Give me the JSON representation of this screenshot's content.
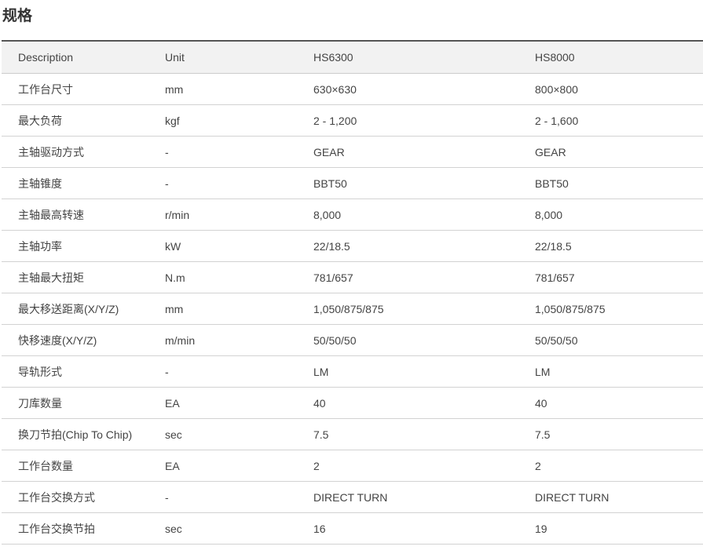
{
  "page": {
    "title": "规格"
  },
  "table": {
    "headers": [
      "Description",
      "Unit",
      "HS6300",
      "HS8000"
    ],
    "rows": [
      [
        "工作台尺寸",
        "mm",
        "630×630",
        "800×800"
      ],
      [
        "最大负荷",
        "kgf",
        "2 - 1,200",
        "2 - 1,600"
      ],
      [
        "主轴驱动方式",
        "-",
        "GEAR",
        "GEAR"
      ],
      [
        "主轴锥度",
        "-",
        "BBT50",
        "BBT50"
      ],
      [
        "主轴最高转速",
        "r/min",
        "8,000",
        "8,000"
      ],
      [
        "主轴功率",
        "kW",
        "22/18.5",
        "22/18.5"
      ],
      [
        "主轴最大扭矩",
        "N.m",
        "781/657",
        "781/657"
      ],
      [
        "最大移送距离(X/Y/Z)",
        "mm",
        "1,050/875/875",
        "1,050/875/875"
      ],
      [
        "快移速度(X/Y/Z)",
        "m/min",
        "50/50/50",
        "50/50/50"
      ],
      [
        "导轨形式",
        "-",
        "LM",
        "LM"
      ],
      [
        "刀库数量",
        "EA",
        "40",
        "40"
      ],
      [
        "换刀节拍(Chip To Chip)",
        "sec",
        "7.5",
        "7.5"
      ],
      [
        "工作台数量",
        "EA",
        "2",
        "2"
      ],
      [
        "工作台交换方式",
        "-",
        "DIRECT TURN",
        "DIRECT TURN"
      ],
      [
        "工作台交换节拍",
        "sec",
        "16",
        "19"
      ]
    ]
  }
}
